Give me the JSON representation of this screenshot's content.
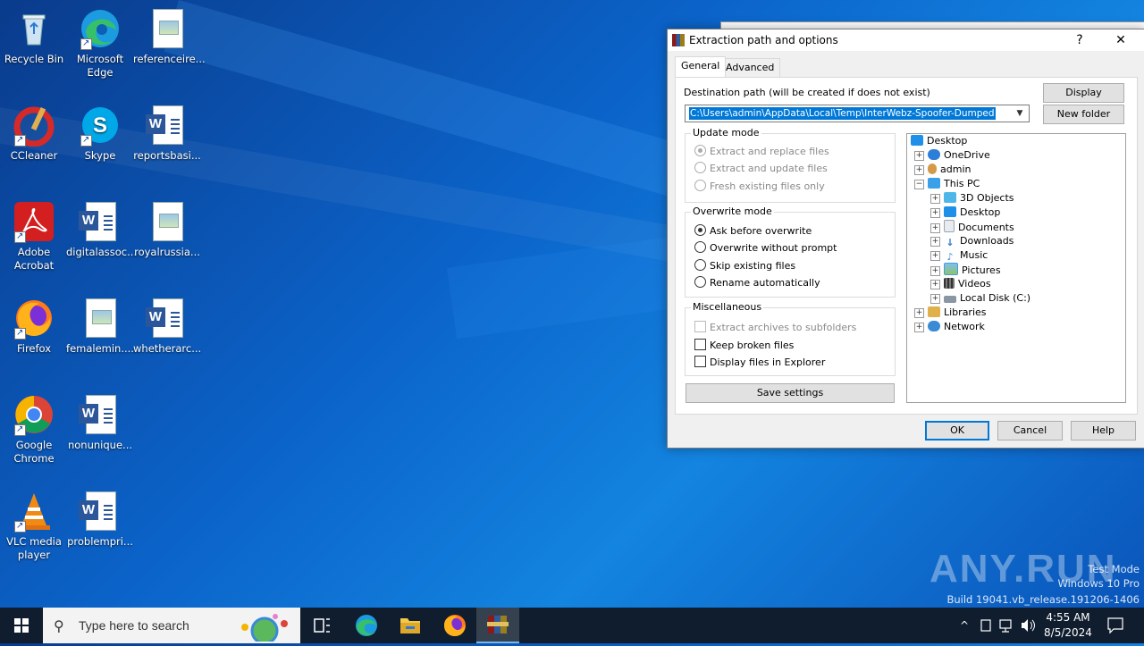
{
  "desktop": {
    "icons": [
      {
        "label": "Recycle Bin"
      },
      {
        "label": "Microsoft Edge"
      },
      {
        "label": "referenceire..."
      },
      {
        "label": "CCleaner"
      },
      {
        "label": "Skype"
      },
      {
        "label": "reportsbasi..."
      },
      {
        "label": "Adobe Acrobat"
      },
      {
        "label": "digitalassoc..."
      },
      {
        "label": "royalrussia..."
      },
      {
        "label": "Firefox"
      },
      {
        "label": "femalemin...."
      },
      {
        "label": "whetherarc..."
      },
      {
        "label": "Google Chrome"
      },
      {
        "label": "nonunique..."
      },
      {
        "label": "VLC media player"
      },
      {
        "label": "problempri..."
      }
    ]
  },
  "dialog": {
    "title": "Extraction path and options",
    "help_glyph": "?",
    "close_glyph": "✕",
    "tabs": [
      {
        "label": "General"
      },
      {
        "label": "Advanced"
      }
    ],
    "dest_label": "Destination path (will be created if does not exist)",
    "dest_value": "C:\\Users\\admin\\AppData\\Local\\Temp\\InterWebz-Spoofer-Dumped",
    "display_btn": "Display",
    "new_folder_btn": "New folder",
    "update_mode": {
      "title": "Update mode",
      "options": [
        {
          "label": "Extract and replace files",
          "selected": true
        },
        {
          "label": "Extract and update files",
          "selected": false
        },
        {
          "label": "Fresh existing files only",
          "selected": false
        }
      ]
    },
    "overwrite_mode": {
      "title": "Overwrite mode",
      "options": [
        {
          "label": "Ask before overwrite",
          "selected": true
        },
        {
          "label": "Overwrite without prompt",
          "selected": false
        },
        {
          "label": "Skip existing files",
          "selected": false
        },
        {
          "label": "Rename automatically",
          "selected": false
        }
      ]
    },
    "misc": {
      "title": "Miscellaneous",
      "options": [
        {
          "label": "Extract archives to subfolders",
          "checked": false,
          "disabled": true
        },
        {
          "label": "Keep broken files",
          "checked": false,
          "disabled": false
        },
        {
          "label": "Display files in Explorer",
          "checked": false,
          "disabled": false
        }
      ]
    },
    "save_settings_btn": "Save settings",
    "tree": [
      {
        "label": "Desktop",
        "exp": "",
        "color": "#1e90e8"
      },
      {
        "label": "OneDrive",
        "exp": "+",
        "color": "#2c7fd8"
      },
      {
        "label": "admin",
        "exp": "+",
        "color": "#d49a4a"
      },
      {
        "label": "This PC",
        "exp": "−",
        "color": "#3aa0e8"
      },
      {
        "label": "3D Objects",
        "exp": "+",
        "color": "#4fb7e8"
      },
      {
        "label": "Desktop",
        "exp": "+",
        "color": "#1e90e8"
      },
      {
        "label": "Documents",
        "exp": "+",
        "color": "#9aa4ad"
      },
      {
        "label": "Downloads",
        "exp": "+",
        "color": "#2a7ad6"
      },
      {
        "label": "Music",
        "exp": "+",
        "color": "#3a8ad6"
      },
      {
        "label": "Pictures",
        "exp": "+",
        "color": "#4c9ad8"
      },
      {
        "label": "Videos",
        "exp": "+",
        "color": "#555c66"
      },
      {
        "label": "Local Disk (C:)",
        "exp": "+",
        "color": "#8a96a4"
      },
      {
        "label": "Libraries",
        "exp": "+",
        "color": "#e0b04a"
      },
      {
        "label": "Network",
        "exp": "+",
        "color": "#3a8ad6"
      }
    ],
    "ok_btn": "OK",
    "cancel_btn": "Cancel",
    "help_btn": "Help"
  },
  "watermark": {
    "brand": "ANY.RUN",
    "line1": "Test Mode",
    "line2": "Windows 10 Pro",
    "line3": "Build 19041.vb_release.191206-1406"
  },
  "taskbar": {
    "search_placeholder": "Type here to search",
    "time": "4:55 AM",
    "date": "8/5/2024"
  }
}
